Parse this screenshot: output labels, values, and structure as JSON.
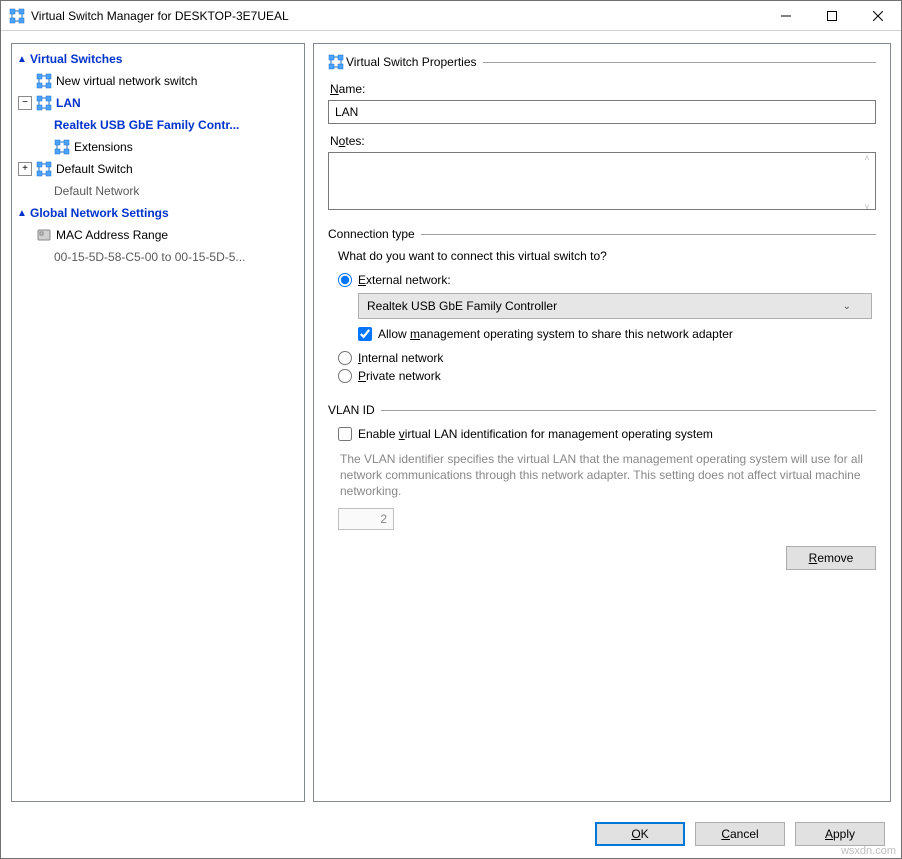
{
  "window": {
    "title": "Virtual Switch Manager for DESKTOP-3E7UEAL"
  },
  "tree": {
    "header_switches": "Virtual Switches",
    "new_switch": "New virtual network switch",
    "lan": "LAN",
    "lan_adapter": "Realtek USB GbE Family Contr...",
    "extensions": "Extensions",
    "default_switch": "Default Switch",
    "default_network": "Default Network",
    "header_global": "Global Network Settings",
    "mac_range": "MAC Address Range",
    "mac_value": "00-15-5D-58-C5-00 to 00-15-5D-5..."
  },
  "props": {
    "section_title": "Virtual Switch Properties",
    "name_label": "Name:",
    "name_value": "LAN",
    "notes_label": "Notes:",
    "notes_value": "",
    "conn": {
      "group_title": "Connection type",
      "question": "What do you want to connect this virtual switch to?",
      "external_label": "External network:",
      "adapter_selected": "Realtek USB GbE Family Controller",
      "allow_mgmt_label": "Allow management operating system to share this network adapter",
      "allow_mgmt_checked": true,
      "internal_label": "Internal network",
      "private_label": "Private network",
      "selected": "external"
    },
    "vlan": {
      "group_title": "VLAN ID",
      "enable_label": "Enable virtual LAN identification for management operating system",
      "enable_checked": false,
      "description": "The VLAN identifier specifies the virtual LAN that the management operating system will use for all network communications through this network adapter. This setting does not affect virtual machine networking.",
      "value": "2"
    },
    "remove_label": "Remove"
  },
  "buttons": {
    "ok": "OK",
    "cancel": "Cancel",
    "apply": "Apply"
  },
  "watermark": "wsxdn.com"
}
